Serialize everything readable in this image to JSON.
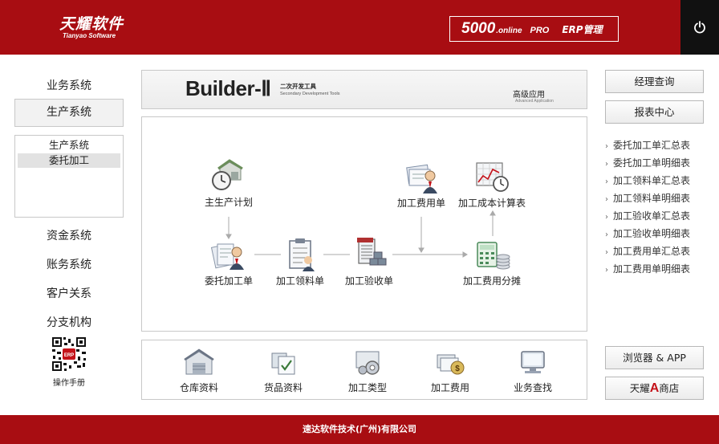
{
  "header": {
    "logo_main": "天耀软件",
    "logo_sub": "Tianyao Software",
    "product_num": "5000",
    "product_online": ".online",
    "product_pro": "PRO",
    "product_erp": "ERP管理",
    "power_icon": "power-icon"
  },
  "nav": {
    "items": [
      "业务系统",
      "生产系统",
      "资金系统",
      "账务系统",
      "客户关系",
      "分支机构"
    ],
    "active": "生产系统",
    "sub_items": [
      "生产系统",
      "委托加工"
    ],
    "selected_sub": "委托加工",
    "manual_label": "操作手册"
  },
  "banner": {
    "title": "Builder-Ⅱ",
    "subtitle_cn": "二次开发工具",
    "subtitle_en": "Secondary Development Tools",
    "advanced": "高级应用",
    "advanced_en": "Advanced Application"
  },
  "flow": {
    "nodes": [
      {
        "label": "主生产计划",
        "icon": "production-plan-icon"
      },
      {
        "label": "委托加工单",
        "icon": "outsource-order-icon"
      },
      {
        "label": "加工领料单",
        "icon": "material-requisition-icon"
      },
      {
        "label": "加工验收单",
        "icon": "acceptance-icon"
      },
      {
        "label": "加工费用单",
        "icon": "processing-fee-icon"
      },
      {
        "label": "加工成本计算表",
        "icon": "cost-calculation-icon"
      },
      {
        "label": "加工费用分摊",
        "icon": "fee-allocation-icon"
      }
    ]
  },
  "shortcuts": [
    {
      "label": "仓库资料",
      "icon": "warehouse-icon"
    },
    {
      "label": "货品资料",
      "icon": "goods-icon"
    },
    {
      "label": "加工类型",
      "icon": "processing-type-icon"
    },
    {
      "label": "加工费用",
      "icon": "fee-icon"
    },
    {
      "label": "业务查找",
      "icon": "business-search-icon"
    }
  ],
  "right": {
    "manager_query": "经理查询",
    "report_center": "报表中心",
    "reports": [
      "委托加工单汇总表",
      "委托加工单明细表",
      "加工领料单汇总表",
      "加工领料单明细表",
      "加工验收单汇总表",
      "加工验收单明细表",
      "加工费用单汇总表",
      "加工费用单明细表"
    ],
    "browser_app": "浏览器 & APP",
    "store_prefix": "天耀",
    "store_a": "A",
    "store_suffix": "商店"
  },
  "footer": {
    "company": "速达软件技术(广州)有限公司"
  },
  "colors": {
    "brand_red": "#a80d12",
    "power_bg": "#111111"
  }
}
